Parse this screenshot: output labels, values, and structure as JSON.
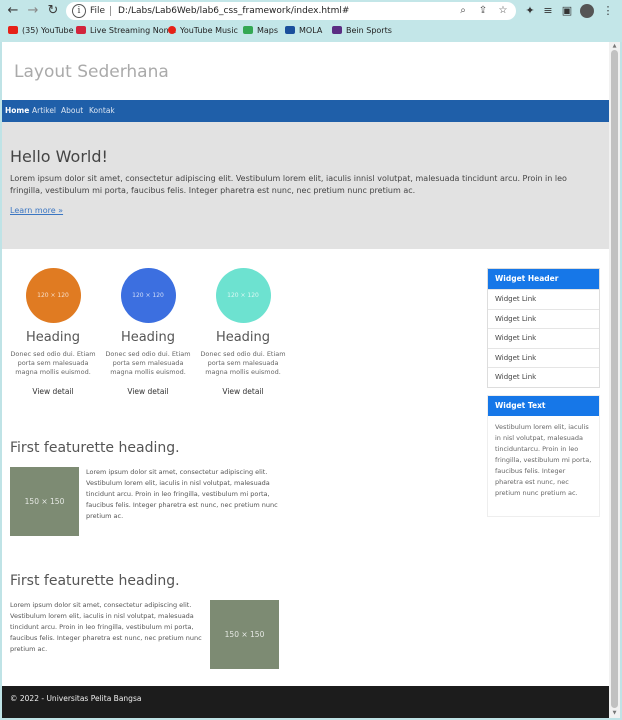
{
  "browser": {
    "file_label": "File",
    "url": "D:/Labs/Lab6Web/lab6_css_framework/index.html#",
    "bookmarks": [
      {
        "label": "(35) YouTube",
        "color": "#e62117"
      },
      {
        "label": "Live Streaming Non...",
        "color": "#d2243c"
      },
      {
        "label": "YouTube Music",
        "color": "#e62117"
      },
      {
        "label": "Maps",
        "color": "#34a853"
      },
      {
        "label": "MOLA",
        "color": "#1b4f9c"
      },
      {
        "label": "Bein Sports",
        "color": "#5b2c83"
      }
    ]
  },
  "site": {
    "title": "Layout Sederhana",
    "nav": [
      "Home",
      "Artikel",
      "About",
      "Kontak"
    ]
  },
  "hero": {
    "title": "Hello World!",
    "text": "Lorem ipsum dolor sit amet, consectetur adipiscing elit. Vestibulum lorem elit, iaculis innisl volutpat, malesuada tincidunt arcu. Proin in leo fringilla, vestibulum mi porta, faucibus felis. Integer pharetra est nunc, nec pretium nunc pretium ac.",
    "link": "Learn more »"
  },
  "columns": [
    {
      "img_label": "120 × 120",
      "color": "#e07b22",
      "heading": "Heading",
      "text": "Donec sed odio dui. Etiam porta sem malesuada magna mollis euismod.",
      "link": "View detail"
    },
    {
      "img_label": "120 × 120",
      "color": "#3c6fe0",
      "heading": "Heading",
      "text": "Donec sed odio dui. Etiam porta sem malesuada magna mollis euismod.",
      "link": "View detail"
    },
    {
      "img_label": "120 × 120",
      "color": "#6de2d0",
      "heading": "Heading",
      "text": "Donec sed odio dui. Etiam porta sem malesuada magna mollis euismod.",
      "link": "View detail"
    }
  ],
  "featurettes": [
    {
      "title": "First featurette heading.",
      "img_label": "150 × 150",
      "text": "Lorem ipsum dolor sit amet, consectetur adipiscing elit. Vestibulum lorem elit, iaculis in nisl volutpat, malesuada tincidunt arcu. Proin in leo fringilla, vestibulum mi porta, faucibus felis. Integer pharetra est nunc, nec pretium nunc pretium ac."
    },
    {
      "title": "First featurette heading.",
      "img_label": "150 × 150",
      "text": "Lorem ipsum dolor sit amet, consectetur adipiscing elit. Vestibulum lorem elit, iaculis in nisl volutpat, malesuada tincidunt arcu. Proin in leo fringilla, vestibulum mi porta, faucibus felis. Integer pharetra est nunc, nec pretium nunc pretium ac."
    }
  ],
  "sidebar": {
    "widget_header": "Widget Header",
    "links": [
      "Widget Link",
      "Widget Link",
      "Widget Link",
      "Widget Link",
      "Widget Link"
    ],
    "widget_text_header": "Widget Text",
    "widget_text": "Vestibulum lorem elit, iaculis in nisl volutpat, malesuada tinciduntarcu. Proin in leo fringilla, vestibulum mi porta, faucibus felis. Integer pharetra est nunc, nec pretium nunc pretium ac."
  },
  "footer": "© 2022 - Universitas Pelita Bangsa"
}
